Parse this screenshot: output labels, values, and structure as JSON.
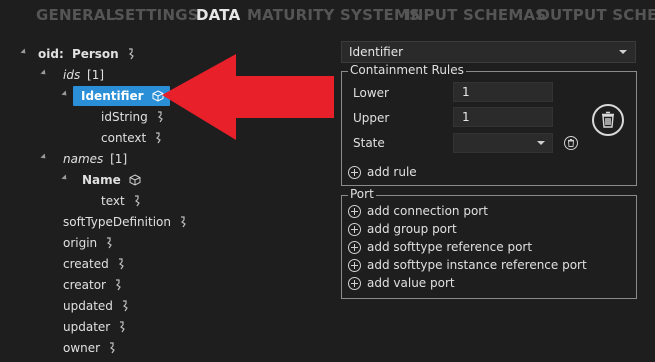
{
  "tabs": [
    {
      "label": "GENERAL",
      "active": false
    },
    {
      "label": "SETTINGS",
      "active": false
    },
    {
      "label": "DATA",
      "active": true
    },
    {
      "label": "MATURITY SYSTEMS",
      "active": false
    },
    {
      "label": "INPUT SCHEMAS",
      "active": false
    },
    {
      "label": "OUTPUT SCHEMA",
      "active": false
    }
  ],
  "tree": {
    "root_label": "oid:",
    "root_type": "Person",
    "ids_label": "ids",
    "ids_count": "[1]",
    "identifier": "Identifier",
    "idString": "idString",
    "context": "context",
    "names_label": "names",
    "names_count": "[1]",
    "name": "Name",
    "text": "text",
    "fields": [
      "softTypeDefinition",
      "origin",
      "created",
      "creator",
      "updated",
      "updater",
      "owner"
    ]
  },
  "panel": {
    "selected_type": "Identifier",
    "containment_title": "Containment Rules",
    "lower_label": "Lower",
    "lower_value": "1",
    "upper_label": "Upper",
    "upper_value": "1",
    "state_label": "State",
    "state_value": "",
    "add_rule": "add rule",
    "port_title": "Port",
    "port_actions": [
      "add connection port",
      "add group port",
      "add softtype reference port",
      "add softtype instance reference port",
      "add value port"
    ]
  },
  "colors": {
    "accent": "#2a8fd6",
    "arrow": "#e8202a",
    "background": "#1e1e1e"
  }
}
